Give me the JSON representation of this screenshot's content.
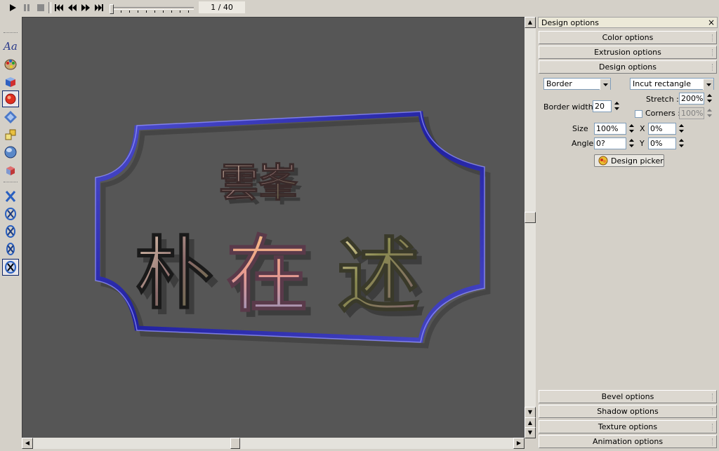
{
  "toolbar": {
    "buttons": [
      "play-icon",
      "pause-icon",
      "stop-icon",
      "skip-to-start-icon",
      "rewind-icon",
      "fast-forward-icon",
      "skip-to-end-icon"
    ],
    "frame_counter": "1 / 40",
    "timeline_position": 0
  },
  "tools": [
    "text-tool-icon",
    "color-palette-icon",
    "extrusion-cube-icon",
    "border-design-icon",
    "bevel-diamond-icon",
    "shadow-shapes-icon",
    "texture-sphere-icon",
    "lighting-box-icon",
    "animation-x-icon",
    "animation-rotate-icon",
    "animation-spin-icon",
    "animation-swing-icon",
    "animation-wobble-icon"
  ],
  "preview": {
    "top_text": "雲峯",
    "main_text": [
      "朴",
      "在",
      "述"
    ],
    "background_color": "#565656",
    "border_color": "#2e2ea8"
  },
  "panel": {
    "title": "Design options",
    "close_glyph": "×",
    "sections_top": [
      "Color options",
      "Extrusion options",
      "Design options"
    ],
    "design": {
      "type_value": "Border",
      "shape_value": "Incut rectangle",
      "stretch_label": "Stretch :",
      "stretch_value": "200%",
      "border_width_label": "Border width",
      "border_width_value": "20",
      "corners_label": "Corners :",
      "corners_value": "100%",
      "corners_checked": false,
      "size_label": "Size",
      "size_value": "100%",
      "x_label": "X",
      "x_value": "0%",
      "angle_label": "Angle",
      "angle_value": "0?",
      "y_label": "Y",
      "y_value": "0%",
      "picker_label": "Design picker"
    },
    "sections_bottom": [
      "Bevel options",
      "Shadow options",
      "Texture options",
      "Animation options"
    ]
  }
}
